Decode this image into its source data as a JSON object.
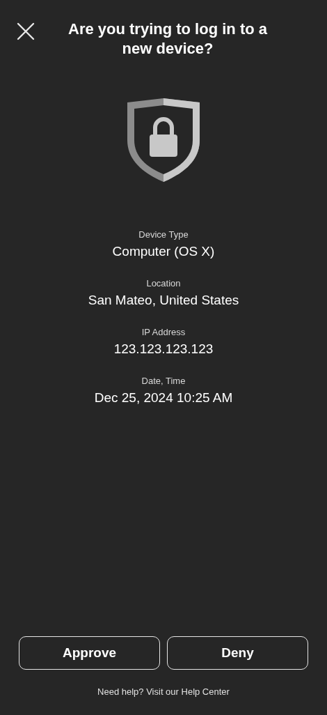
{
  "header": {
    "title": "Are you trying to log in to a new device?"
  },
  "details": [
    {
      "label": "Device Type",
      "value": "Computer (OS X)"
    },
    {
      "label": "Location",
      "value": "San Mateo, United States"
    },
    {
      "label": "IP Address",
      "value": "123.123.123.123"
    },
    {
      "label": "Date, Time",
      "value": "Dec 25, 2024 10:25 AM"
    }
  ],
  "buttons": [
    {
      "label": "Approve"
    },
    {
      "label": "Deny"
    }
  ],
  "footer": "Need help? Visit our Help Center"
}
